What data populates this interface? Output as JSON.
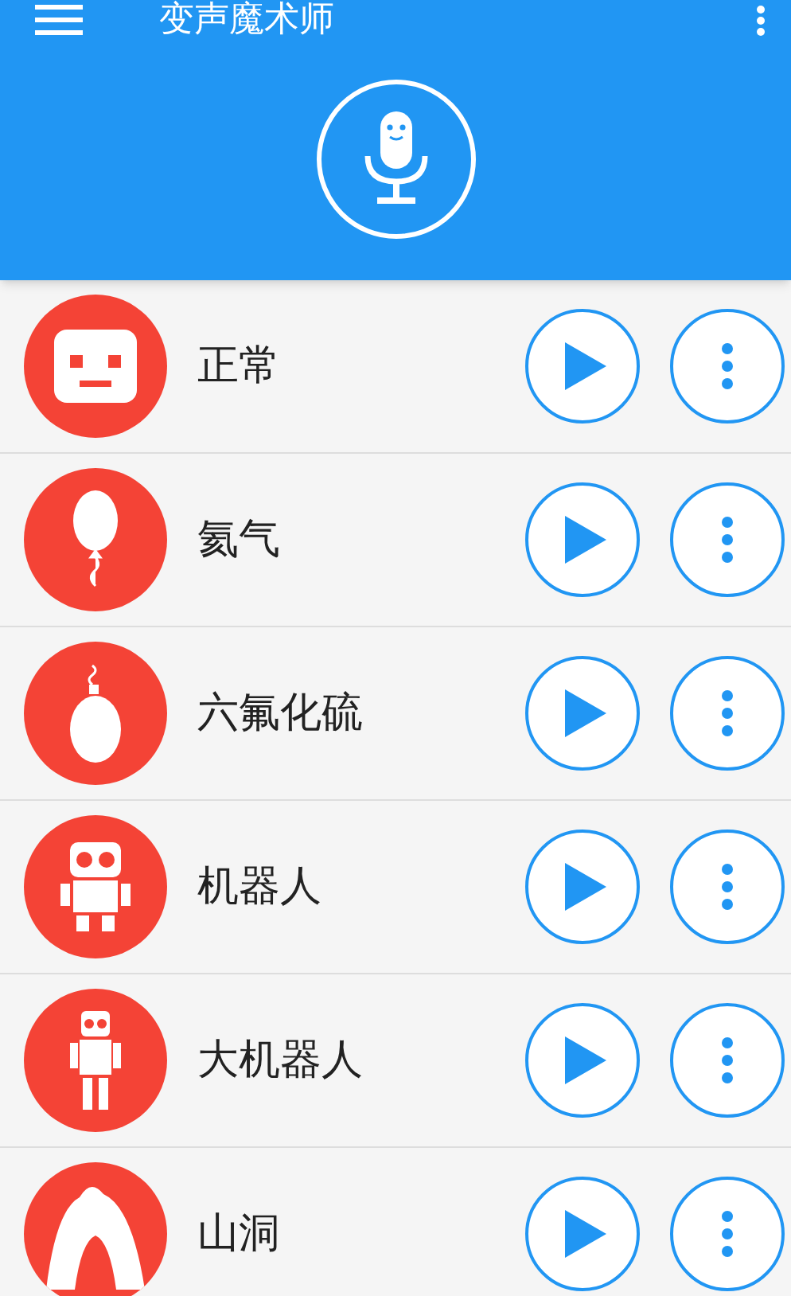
{
  "app_bar": {
    "title": "变声魔术师"
  },
  "effects": [
    {
      "name": "正常"
    },
    {
      "name": "氦气"
    },
    {
      "name": "六氟化硫"
    },
    {
      "name": "机器人"
    },
    {
      "name": "大机器人"
    },
    {
      "name": "山洞"
    }
  ]
}
